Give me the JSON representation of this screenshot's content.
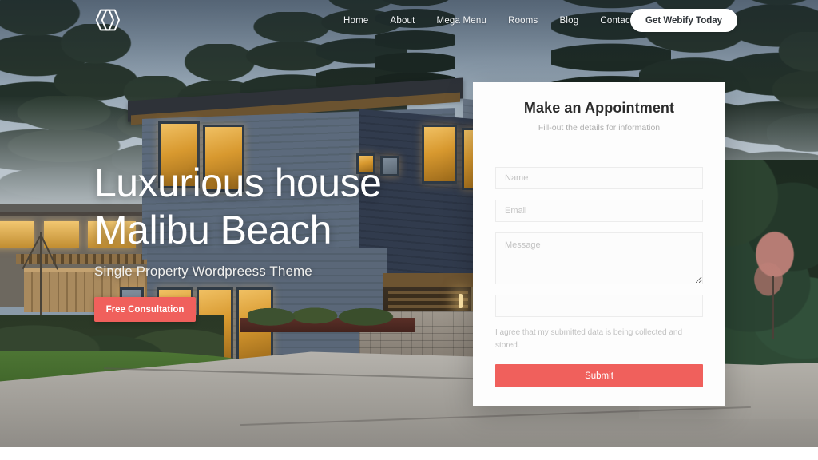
{
  "site": {
    "logo_icon": "overlapping-hexagons-logo"
  },
  "nav": {
    "items": [
      {
        "label": "Home"
      },
      {
        "label": "About"
      },
      {
        "label": "Mega Menu"
      },
      {
        "label": "Rooms"
      },
      {
        "label": "Blog"
      },
      {
        "label": "Contact"
      }
    ],
    "cta_label": "Get Webify Today"
  },
  "hero": {
    "title_line1": "Luxurious house",
    "title_line2": "Malibu Beach",
    "subtitle": "Single Property Wordpreess Theme",
    "button_label": "Free Consultation"
  },
  "form": {
    "title": "Make an Appointment",
    "subtitle": "Fill-out the details for information",
    "name_placeholder": "Name",
    "name_value": "",
    "email_placeholder": "Email",
    "email_value": "",
    "message_placeholder": "Message",
    "message_value": "",
    "extra_placeholder": "",
    "extra_value": "",
    "consent_text": "I agree that my submitted data is being collected and stored.",
    "submit_label": "Submit"
  },
  "colors": {
    "accent_red": "#f0605c",
    "card_background": "#fdfdfd",
    "nav_text": "#f2f4f6",
    "heading_dark": "#2b2b2b",
    "muted_text": "#c0c0c0"
  }
}
